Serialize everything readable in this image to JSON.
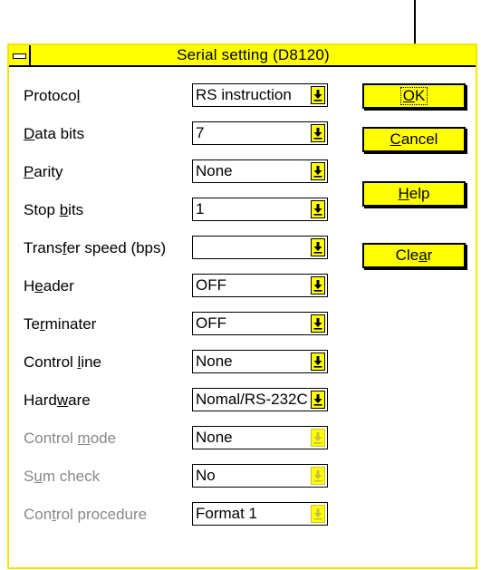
{
  "window": {
    "title": "Serial setting (D8120)"
  },
  "fields": [
    {
      "id": "protocol",
      "label_pre": "Protoco",
      "label_u": "l",
      "label_post": "",
      "value": "RS instruction",
      "disabled": false
    },
    {
      "id": "data-bits",
      "label_pre": "",
      "label_u": "D",
      "label_post": "ata bits",
      "value": "7",
      "disabled": false
    },
    {
      "id": "parity",
      "label_pre": "",
      "label_u": "P",
      "label_post": "arity",
      "value": "None",
      "disabled": false
    },
    {
      "id": "stop-bits",
      "label_pre": "Stop ",
      "label_u": "b",
      "label_post": "its",
      "value": "1",
      "disabled": false
    },
    {
      "id": "transfer-speed",
      "label_pre": "Trans",
      "label_u": "f",
      "label_post": "er speed (bps)",
      "value": "",
      "disabled": false
    },
    {
      "id": "header",
      "label_pre": "H",
      "label_u": "e",
      "label_post": "ader",
      "value": "OFF",
      "disabled": false
    },
    {
      "id": "terminater",
      "label_pre": "Te",
      "label_u": "r",
      "label_post": "minater",
      "value": "OFF",
      "disabled": false
    },
    {
      "id": "control-line",
      "label_pre": "Control ",
      "label_u": "l",
      "label_post": "ine",
      "value": "None",
      "disabled": false
    },
    {
      "id": "hardware",
      "label_pre": "Hard",
      "label_u": "w",
      "label_post": "are",
      "value": "Nomal/RS-232C",
      "disabled": false
    },
    {
      "id": "control-mode",
      "label_pre": "Control ",
      "label_u": "m",
      "label_post": "ode",
      "value": "None",
      "disabled": true
    },
    {
      "id": "sum-check",
      "label_pre": "S",
      "label_u": "u",
      "label_post": "m check",
      "value": "No",
      "disabled": true
    },
    {
      "id": "control-procedure",
      "label_pre": "Con",
      "label_u": "t",
      "label_post": "rol procedure",
      "value": "Format 1",
      "disabled": true
    }
  ],
  "buttons": {
    "ok": {
      "pre": "",
      "u": "O",
      "post": "K"
    },
    "cancel": {
      "pre": "",
      "u": "C",
      "post": "ancel"
    },
    "help": {
      "pre": "",
      "u": "H",
      "post": "elp"
    },
    "clear": {
      "pre": "Cle",
      "u": "a",
      "post": "r"
    }
  },
  "icons": {
    "dropdown": "down-arrow-icon",
    "system_menu": "system-menu-icon",
    "pointer": "pointer-arrow-icon"
  },
  "colors": {
    "accent": "#ffff00",
    "disabled_text": "#888888",
    "border": "#000000"
  }
}
